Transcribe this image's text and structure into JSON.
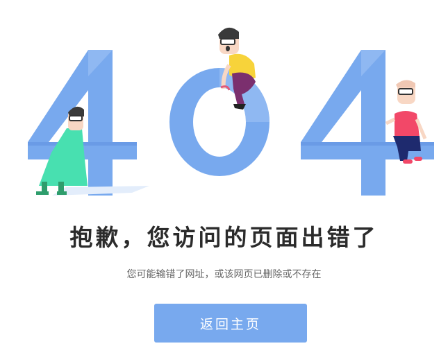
{
  "error_graphic": {
    "digits": [
      "4",
      "0",
      "4"
    ],
    "digit_color": "#78a9ee",
    "digit_shadow_color": "#5d8fe0"
  },
  "title": "抱歉，您访问的页面出错了",
  "subtitle": "您可能输错了网址，或该网页已删除或不存在",
  "home_button": {
    "label": "返回主页",
    "color": "#78a9ee"
  }
}
